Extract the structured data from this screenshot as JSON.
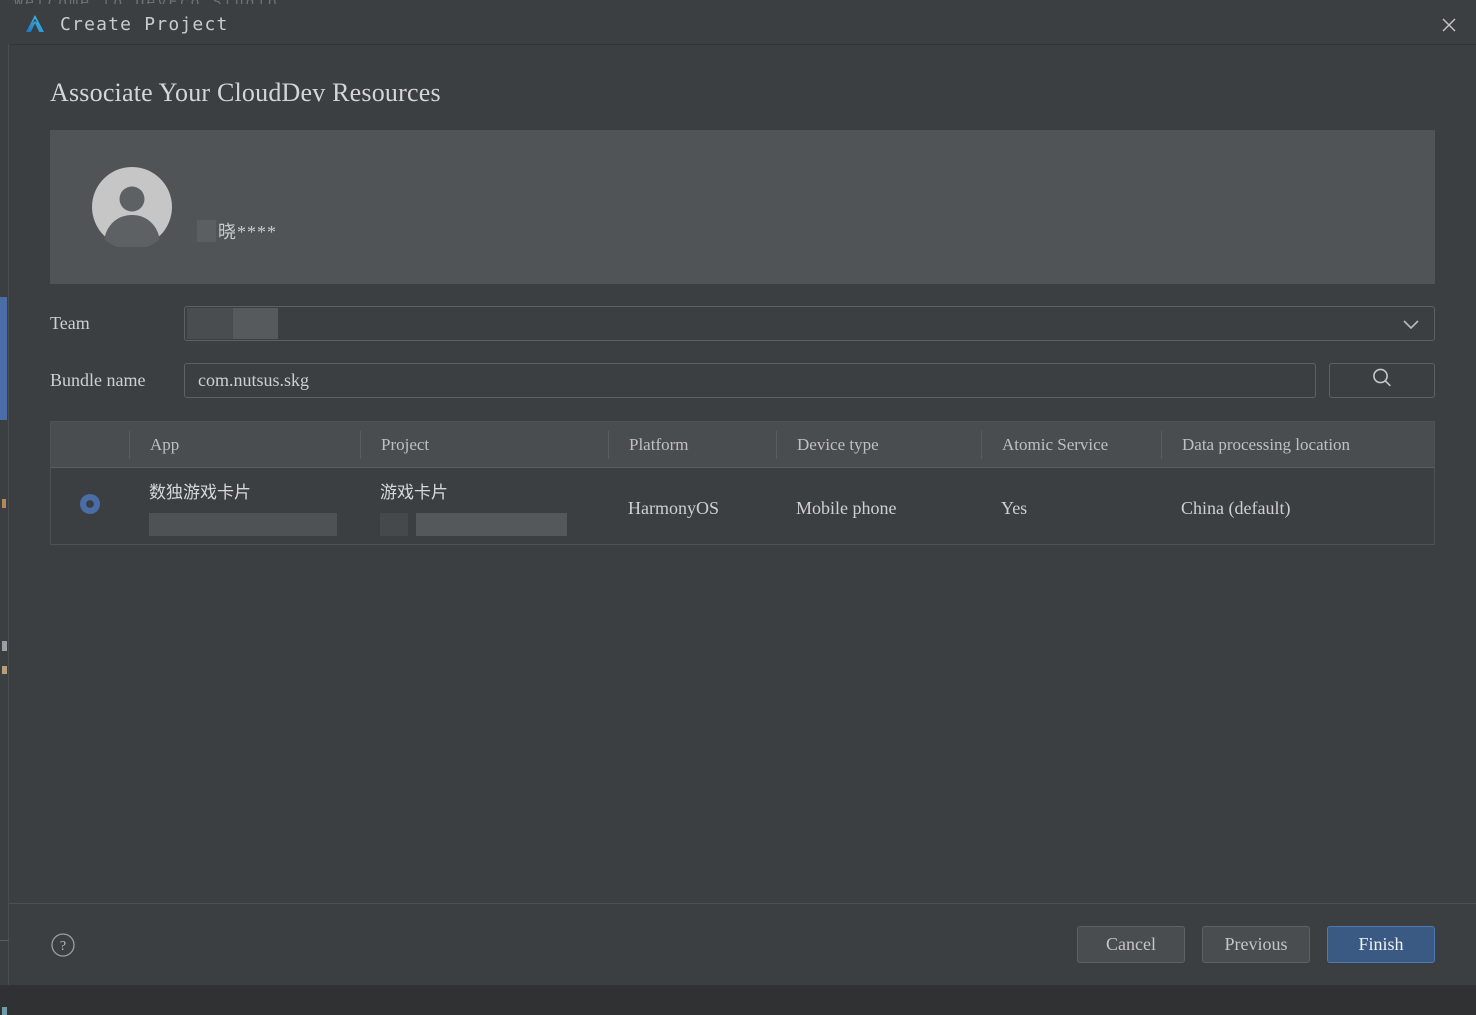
{
  "background_window": {
    "title_partial": "Welcome to DevEco Studio"
  },
  "titlebar": {
    "app_icon": "deveco-studio-logo-icon",
    "title": "Create Project",
    "close_icon": "close-icon"
  },
  "page": {
    "heading": "Associate Your CloudDev Resources"
  },
  "account": {
    "avatar_icon": "user-avatar-icon",
    "redacted_prefix": "",
    "name": "晓****"
  },
  "form": {
    "team": {
      "label": "Team",
      "value": "",
      "chevron_icon": "chevron-down-icon"
    },
    "bundle": {
      "label": "Bundle name",
      "value": "com.nutsus.skg",
      "placeholder": "Bundle name",
      "search_icon": "search-icon"
    }
  },
  "table": {
    "columns": [
      "App",
      "Project",
      "Platform",
      "Device type",
      "Atomic Service",
      "Data processing location"
    ],
    "rows": [
      {
        "selected": true,
        "radio_icon": "radio-selected-icon",
        "app": "数独游戏卡片",
        "app_sub_redacted": "",
        "project": "游戏卡片",
        "project_sub_redacted": "",
        "platform": "HarmonyOS",
        "device_type": "Mobile phone",
        "atomic_service": "Yes",
        "data_processing_location": "China (default)"
      }
    ]
  },
  "footer": {
    "help_icon": "help-circle-icon",
    "cancel_label": "Cancel",
    "previous_label": "Previous",
    "finish_label": "Finish"
  },
  "colors": {
    "dialog_background": "#3c3f41",
    "card_background": "#515456",
    "accent_primary": "#3b5a83",
    "accent_border": "#4d7ab5",
    "radio_selected": "#4a6da7",
    "text_primary": "#cdd0d2",
    "logo_blue": "#2f8cd8",
    "logo_cyan": "#3fc1e0"
  }
}
